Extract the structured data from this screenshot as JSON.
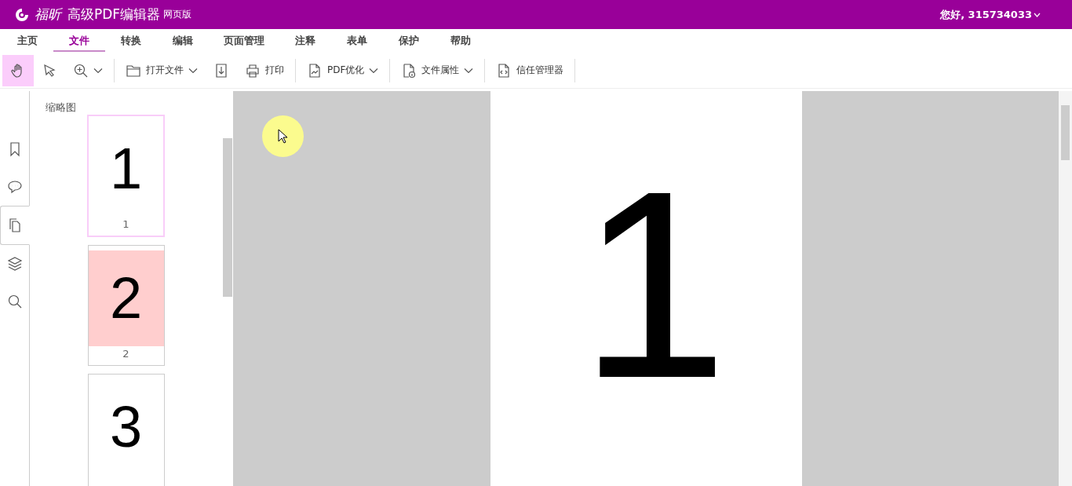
{
  "header": {
    "brand": "福昕",
    "product": "高级PDF编辑器",
    "edition": "网页版",
    "user": "您好, 315734033"
  },
  "menu": [
    {
      "label": "主页",
      "selected": false
    },
    {
      "label": "文件",
      "selected": true
    },
    {
      "label": "转换",
      "selected": false
    },
    {
      "label": "编辑",
      "selected": false
    },
    {
      "label": "页面管理",
      "selected": false
    },
    {
      "label": "注释",
      "selected": false
    },
    {
      "label": "表单",
      "selected": false
    },
    {
      "label": "保护",
      "selected": false
    },
    {
      "label": "帮助",
      "selected": false
    }
  ],
  "toolbar": [
    {
      "kind": "hand",
      "selected": true,
      "dropdown": false,
      "separator": false
    },
    {
      "kind": "select",
      "selected": false,
      "dropdown": false,
      "separator": false
    },
    {
      "kind": "zoom",
      "selected": false,
      "dropdown": true,
      "separator": true
    },
    {
      "kind": "folder",
      "label": "打开文件",
      "selected": false,
      "dropdown": true,
      "separator": false
    },
    {
      "kind": "download",
      "selected": false,
      "dropdown": false,
      "separator": false
    },
    {
      "kind": "print",
      "label": "打印",
      "selected": false,
      "dropdown": false,
      "separator": true
    },
    {
      "kind": "optimize",
      "label": "PDF优化",
      "selected": false,
      "dropdown": true,
      "separator": true
    },
    {
      "kind": "info",
      "label": "文件属性",
      "selected": false,
      "dropdown": true,
      "separator": true
    },
    {
      "kind": "code",
      "label": "信任管理器",
      "selected": false,
      "dropdown": false,
      "separator": true
    }
  ],
  "sidebar_tabs": [
    {
      "kind": "bookmark",
      "selected": false
    },
    {
      "kind": "comment",
      "selected": false
    },
    {
      "kind": "pages",
      "selected": true
    },
    {
      "kind": "layers",
      "selected": false
    },
    {
      "kind": "search",
      "selected": false
    }
  ],
  "thumbnails": {
    "title": "缩略图",
    "pages": [
      {
        "number": "1",
        "label": "1",
        "selected": true,
        "color": "#ffffff"
      },
      {
        "number": "2",
        "label": "2",
        "selected": false,
        "color": "#ffcece"
      },
      {
        "number": "3",
        "selected": false,
        "color": "#ffffff"
      }
    ]
  },
  "document": {
    "page_content": "1"
  }
}
